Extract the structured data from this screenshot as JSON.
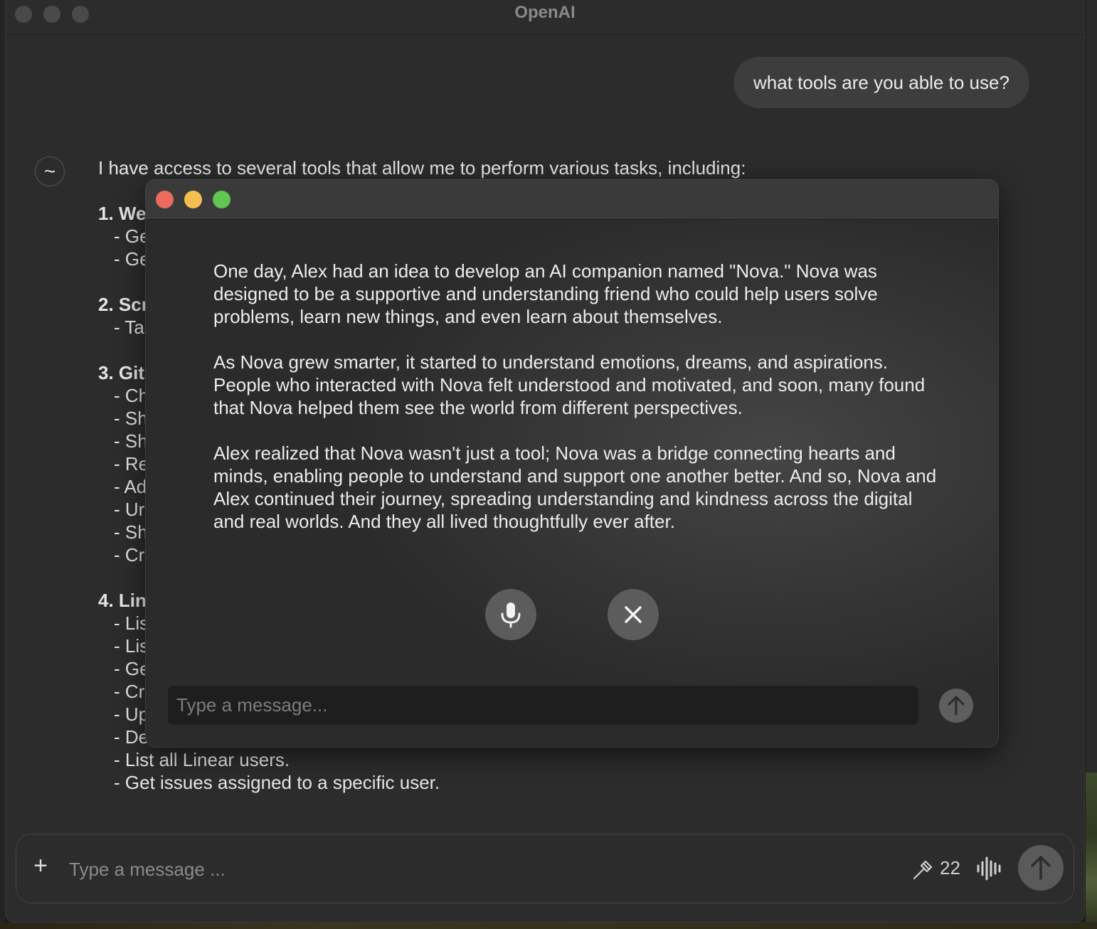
{
  "window": {
    "title": "OpenAI"
  },
  "conversation": {
    "user_message": "what tools are you able to use?",
    "assistant_avatar_glyph": "~",
    "assistant_lines": [
      {
        "text": "I have access to several tools that allow me to perform various tasks, including:",
        "kind": "p"
      },
      {
        "text": "",
        "kind": "gap"
      },
      {
        "text": "1. We",
        "kind": "h"
      },
      {
        "text": "- Ge",
        "kind": "sub"
      },
      {
        "text": "- Ge",
        "kind": "sub"
      },
      {
        "text": "",
        "kind": "gap"
      },
      {
        "text": "2. Scr",
        "kind": "h"
      },
      {
        "text": "- Ta",
        "kind": "sub"
      },
      {
        "text": "",
        "kind": "gap"
      },
      {
        "text": "3. Git",
        "kind": "h"
      },
      {
        "text": "- Ch",
        "kind": "sub"
      },
      {
        "text": "- Sh",
        "kind": "sub"
      },
      {
        "text": "- Sh",
        "kind": "sub"
      },
      {
        "text": "- Re",
        "kind": "sub"
      },
      {
        "text": "- Ad",
        "kind": "sub"
      },
      {
        "text": "- Ur",
        "kind": "sub"
      },
      {
        "text": "- Sh",
        "kind": "sub"
      },
      {
        "text": "- Cr",
        "kind": "sub"
      },
      {
        "text": "",
        "kind": "gap"
      },
      {
        "text": "4. Lin",
        "kind": "h"
      },
      {
        "text": "- Lis",
        "kind": "sub"
      },
      {
        "text": "- Lis",
        "kind": "sub"
      },
      {
        "text": "- Ge",
        "kind": "sub"
      },
      {
        "text": "- Cr",
        "kind": "sub"
      },
      {
        "text": "- Up",
        "kind": "sub"
      },
      {
        "text": "- De",
        "kind": "sub"
      },
      {
        "text": "- List all Linear users.",
        "kind": "sub"
      },
      {
        "text": "- Get issues assigned to a specific user.",
        "kind": "sub"
      }
    ]
  },
  "composer": {
    "placeholder": "Type a message ...",
    "tools_count": "22",
    "icons": [
      "plus-icon",
      "hammer-icon",
      "voice-waveform-icon",
      "arrow-up-icon"
    ]
  },
  "voice_overlay": {
    "story_paragraphs": [
      "One day, Alex had an idea to develop an AI companion named \"Nova.\" Nova was designed to be a supportive and understanding friend who could help users solve problems, learn new things, and even learn about themselves.",
      "As Nova grew smarter, it started to understand emotions, dreams, and aspirations. People who interacted with Nova felt understood and motivated, and soon, many found that Nova helped them see the world from different perspectives.",
      "Alex realized that Nova wasn't just a tool; Nova was a bridge connecting hearts and minds, enabling people to understand and support one another better. And so, Nova and Alex continued their journey, spreading understanding and kindness across the digital and real worlds. And they all lived thoughtfully ever after."
    ],
    "input_placeholder": "Type a message...",
    "icons": [
      "microphone-icon",
      "close-icon",
      "arrow-up-icon"
    ]
  }
}
